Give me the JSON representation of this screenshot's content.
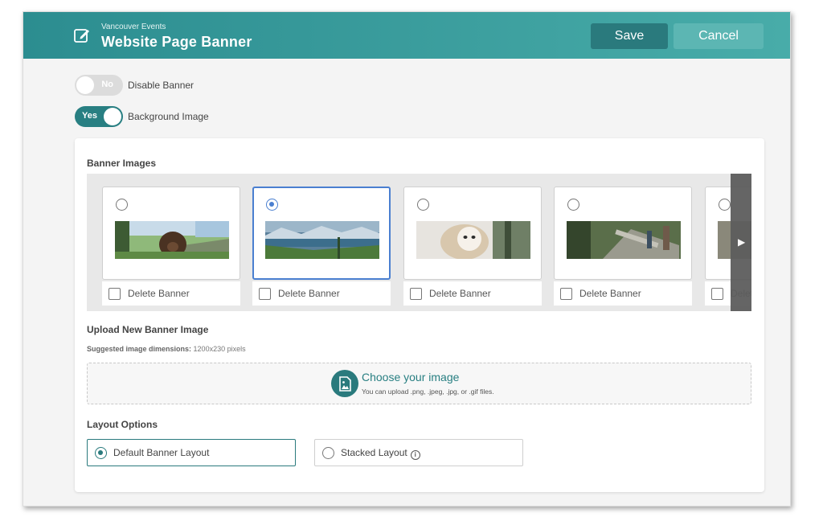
{
  "header": {
    "subtitle": "Vancouver Events",
    "title": "Website Page Banner",
    "save_label": "Save",
    "cancel_label": "Cancel",
    "edit_icon": "edit-icon"
  },
  "toggles": {
    "disable_banner": {
      "state_label": "No",
      "label": "Disable Banner",
      "on": false
    },
    "background_image": {
      "state_label": "Yes",
      "label": "Background Image",
      "on": true
    }
  },
  "banner_images": {
    "title": "Banner Images",
    "delete_label": "Delete Banner",
    "items": [
      {
        "thumbnail": "grizzly bear in forest",
        "selected": false,
        "delete_checked": false
      },
      {
        "thumbnail": "mountain lake with evergreen trees",
        "selected": true,
        "delete_checked": false
      },
      {
        "thumbnail": "barn owl in snow",
        "selected": false,
        "delete_checked": false
      },
      {
        "thumbnail": "forest trail with people",
        "selected": false,
        "delete_checked": false
      },
      {
        "thumbnail": "partially visible banner",
        "selected": false,
        "delete_checked": false
      }
    ]
  },
  "upload": {
    "title": "Upload New Banner Image",
    "hint_label": "Suggested image dimensions:",
    "hint_value": "1200x230 pixels",
    "choose_label": "Choose your image",
    "formats_text": "You can upload .png, .jpeg, .jpg, or .gif files."
  },
  "layout_options": {
    "title": "Layout Options",
    "default_label": "Default Banner Layout",
    "stacked_label": "Stacked Layout",
    "selected": "default"
  },
  "colors": {
    "header_teal": "#2c8d90",
    "accent_teal": "#287f82",
    "selection_blue": "#4a7fd0"
  }
}
